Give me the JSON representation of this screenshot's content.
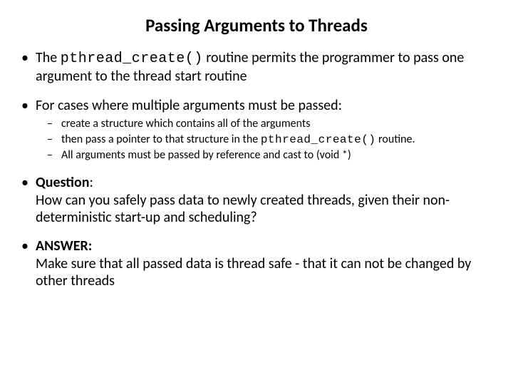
{
  "slide": {
    "title": "Passing Arguments to Threads",
    "bullets": {
      "b1_pre": "The ",
      "b1_code": "pthread_create()",
      "b1_post": " routine permits the programmer to pass one argument to the thread start routine",
      "b2": "For cases where multiple arguments must be passed:",
      "b2_sub1": " create a structure which contains all of the arguments",
      "b2_sub2_pre": "then pass a pointer to that structure in the ",
      "b2_sub2_code": "pthread_create()",
      "b2_sub2_post": "  routine.",
      "b2_sub3": "All arguments must be passed by reference and cast to (void *)",
      "b3_lead": "Question",
      "b3_colon": ":",
      "b3_body": "How can you safely pass data to newly created threads, given their non-deterministic start-up and scheduling?",
      "b4_lead": "ANSWER:",
      "b4_body": "Make sure that all passed data is thread safe - that it can not be changed by other threads"
    }
  }
}
